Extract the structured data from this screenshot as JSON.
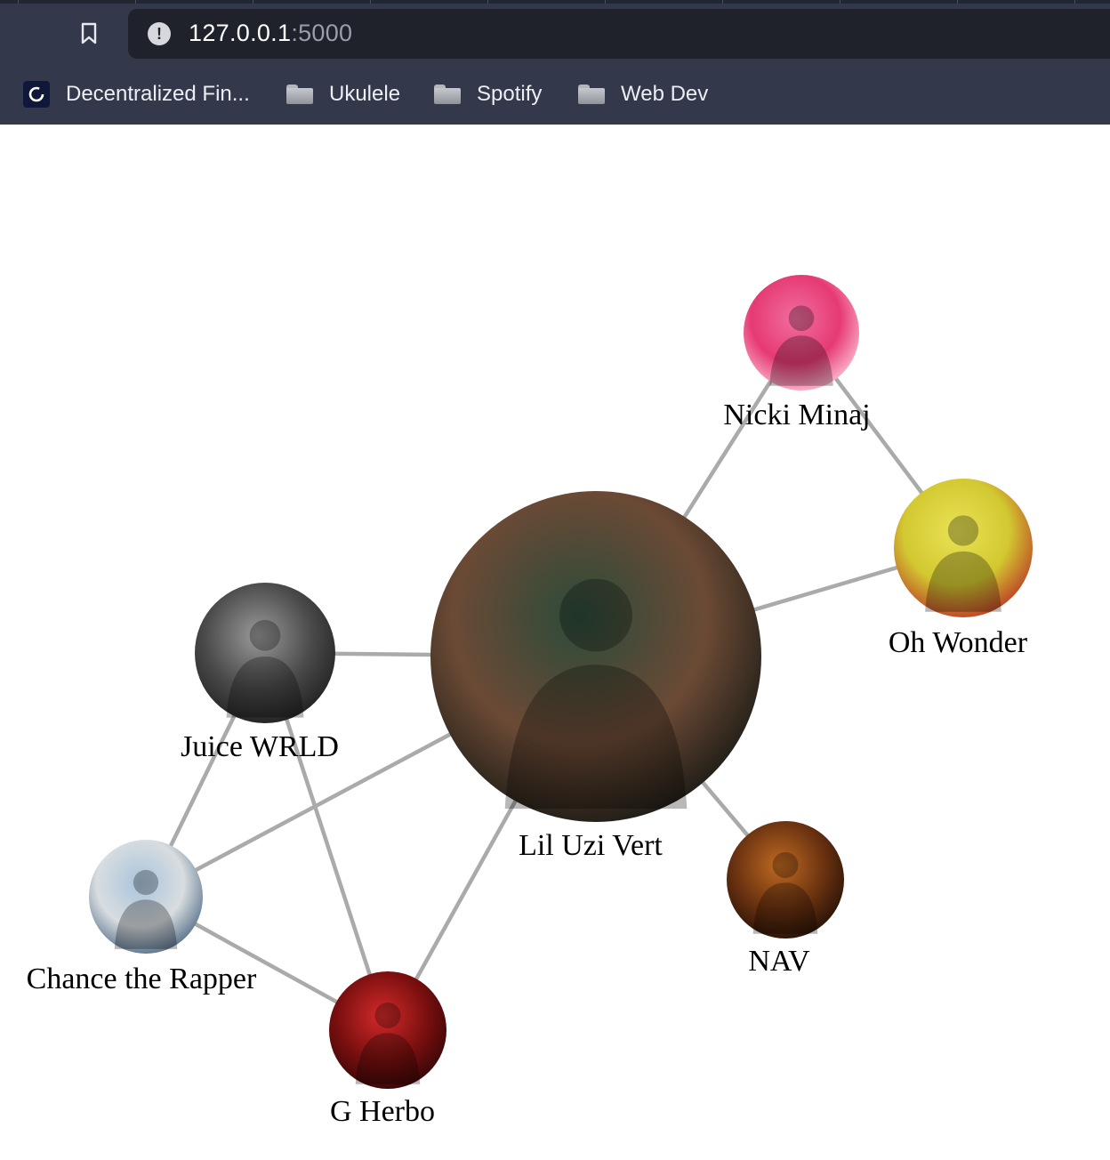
{
  "browser": {
    "url_host": "127.0.0.1",
    "url_port": ":5000",
    "bookmarks": [
      {
        "label": "Decentralized Fin...",
        "icon": "site-favicon-icon"
      },
      {
        "label": "Ukulele",
        "icon": "folder-icon"
      },
      {
        "label": "Spotify",
        "icon": "folder-icon"
      },
      {
        "label": "Web Dev",
        "icon": "folder-icon"
      }
    ]
  },
  "graph": {
    "edge_color": "#aaaaaa",
    "nodes": [
      {
        "id": "lil-uzi-vert",
        "label": "Lil Uzi Vert",
        "colors": [
          "#2c4b3a",
          "#6b4a35",
          "#0d1210"
        ]
      },
      {
        "id": "nicki-minaj",
        "label": "Nicki Minaj",
        "colors": [
          "#f06ea0",
          "#e63a73",
          "#ffd1e0"
        ]
      },
      {
        "id": "oh-wonder",
        "label": "Oh Wonder",
        "colors": [
          "#e9e255",
          "#d2c830",
          "#b82525"
        ]
      },
      {
        "id": "juice-wrld",
        "label": "Juice WRLD",
        "colors": [
          "#9a9a9a",
          "#4a4a4a",
          "#1a1a1a"
        ]
      },
      {
        "id": "chance-the-rapper",
        "label": "Chance the Rapper",
        "colors": [
          "#a9c4dc",
          "#d8dde0",
          "#3e5c7a"
        ]
      },
      {
        "id": "g-herbo",
        "label": "G Herbo",
        "colors": [
          "#d42a2a",
          "#7a0f0f",
          "#2a0505"
        ]
      },
      {
        "id": "nav",
        "label": "NAV",
        "colors": [
          "#c06a22",
          "#6a3210",
          "#1a0c05"
        ]
      }
    ],
    "edges": [
      [
        "lil-uzi-vert",
        "nicki-minaj"
      ],
      [
        "nicki-minaj",
        "oh-wonder"
      ],
      [
        "lil-uzi-vert",
        "oh-wonder"
      ],
      [
        "lil-uzi-vert",
        "juice-wrld"
      ],
      [
        "lil-uzi-vert",
        "chance-the-rapper"
      ],
      [
        "lil-uzi-vert",
        "g-herbo"
      ],
      [
        "lil-uzi-vert",
        "nav"
      ],
      [
        "juice-wrld",
        "chance-the-rapper"
      ],
      [
        "juice-wrld",
        "g-herbo"
      ],
      [
        "chance-the-rapper",
        "g-herbo"
      ]
    ]
  }
}
